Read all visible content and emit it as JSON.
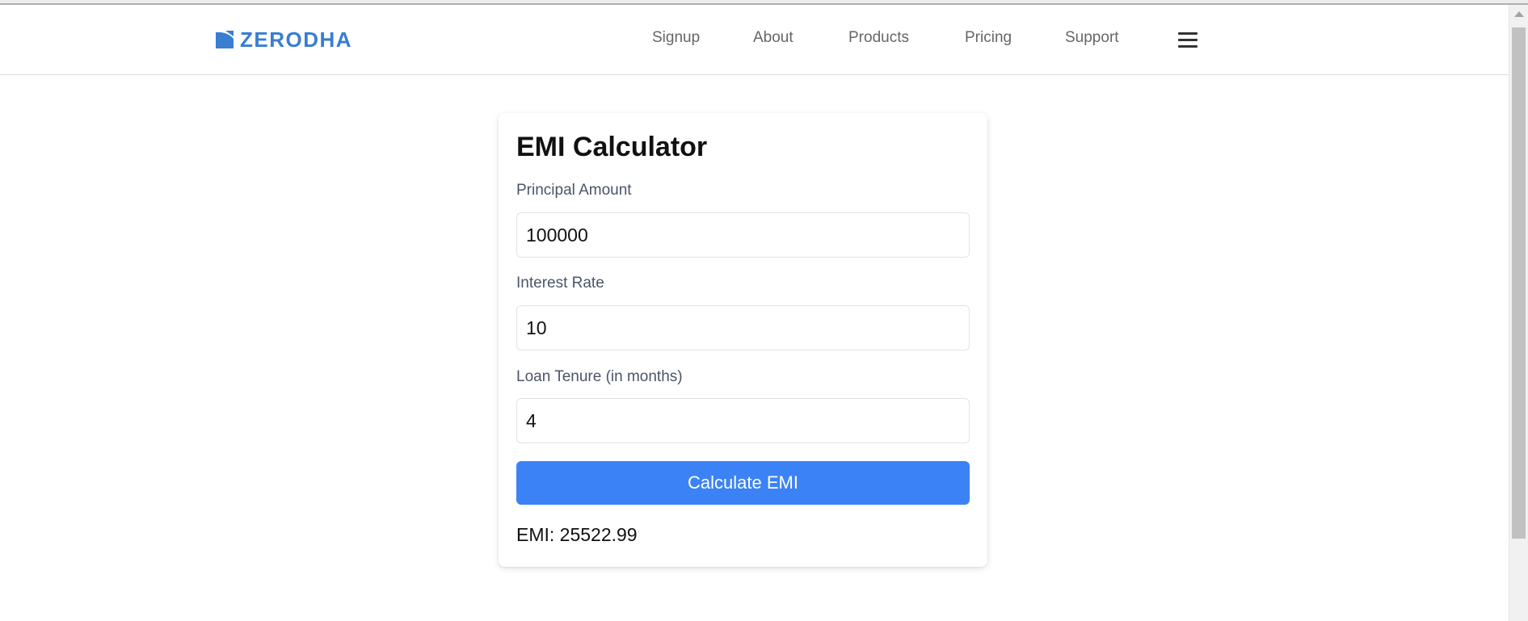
{
  "brand": {
    "name": "ZERODHA",
    "color": "#387ed1",
    "icon": "zerodha-logo-mark"
  },
  "nav": {
    "links": [
      "Signup",
      "About",
      "Products",
      "Pricing",
      "Support"
    ],
    "menu_icon": "hamburger-menu-icon"
  },
  "calculator": {
    "title": "EMI Calculator",
    "principal": {
      "label": "Principal Amount",
      "value": "100000"
    },
    "rate": {
      "label": "Interest Rate",
      "value": "10"
    },
    "tenure": {
      "label": "Loan Tenure (in months)",
      "value": "4"
    },
    "button_label": "Calculate EMI",
    "button_color": "#3b82f6",
    "result": "EMI: 25522.99"
  }
}
